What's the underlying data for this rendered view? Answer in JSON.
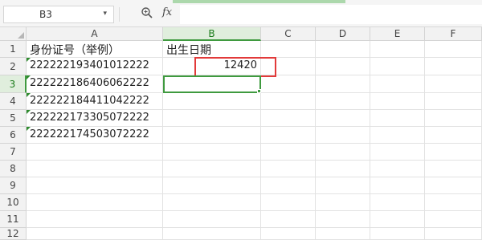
{
  "toolbar": {
    "name_box": "B3",
    "name_box_arrow": "▾",
    "zoom_icon": "zoom-lookup-icon",
    "fx_label": "fx",
    "formula": ""
  },
  "sheet": {
    "columns": [
      "A",
      "B",
      "C",
      "D",
      "E",
      "F"
    ],
    "rows": [
      "1",
      "2",
      "3",
      "4",
      "5",
      "6",
      "7",
      "8",
      "9",
      "10",
      "11",
      "12"
    ],
    "active_cell": "B3",
    "cells": {
      "A1": "身份证号（举例）",
      "B1": "出生日期",
      "A2": "222222193401012222",
      "B2": "12420",
      "A3": "222222186406062222",
      "A4": "222222184411042222",
      "A5": "222222173305072222",
      "A6": "222222174503072222"
    }
  },
  "colors": {
    "selection": "#3f9a3f",
    "annotation": "#e23a3a",
    "error_indicator": "#2e8b2e"
  }
}
